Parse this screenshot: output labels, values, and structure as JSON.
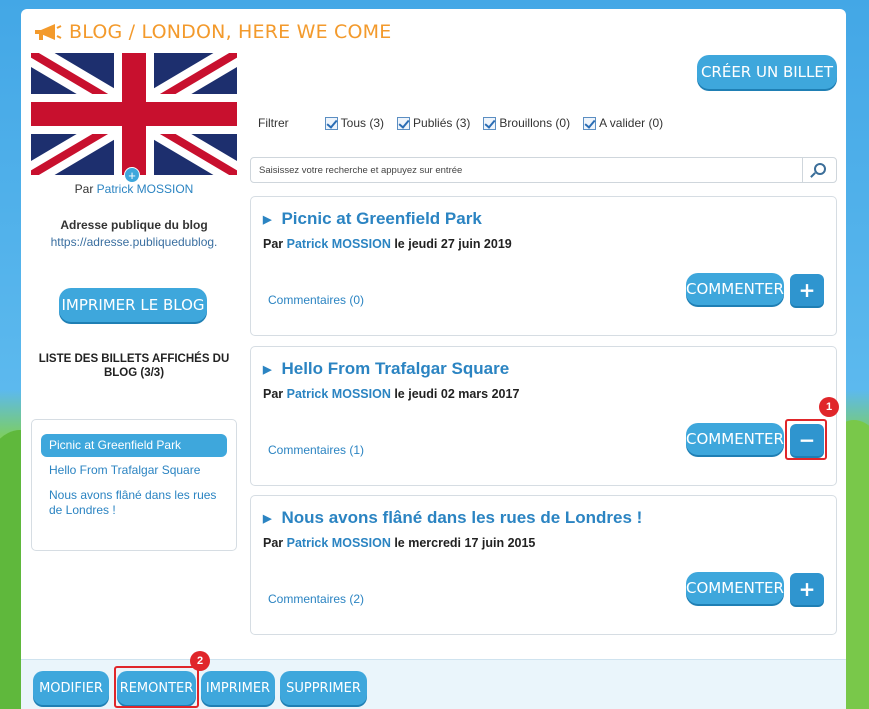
{
  "header": {
    "title": "BLOG / LONDON, HERE WE COME",
    "title_color": "#f39a2c"
  },
  "sidebar": {
    "par_prefix": "Par",
    "author": "Patrick MOSSION",
    "address_label": "Adresse publique du blog",
    "address_url": "https://adresse.publiquedublog.",
    "print_button": "IMPRIMER LE BLOG",
    "list_title": "LISTE DES BILLETS AFFICHÉS DU BLOG (3/3)",
    "items": [
      {
        "label": "Picnic at Greenfield Park",
        "active": true
      },
      {
        "label": "Hello From Trafalgar Square",
        "active": false
      },
      {
        "label": "Nous avons flâné dans les rues de Londres !",
        "active": false
      }
    ]
  },
  "toolbar": {
    "create_button": "CRÉER UN BILLET"
  },
  "filters": {
    "label": "Filtrer",
    "options": [
      {
        "label": "Tous (3)",
        "checked": true
      },
      {
        "label": "Publiés (3)",
        "checked": true
      },
      {
        "label": "Brouillons (0)",
        "checked": true
      },
      {
        "label": "A valider (0)",
        "checked": true
      }
    ]
  },
  "search": {
    "placeholder": "Saisissez votre recherche et appuyez sur entrée"
  },
  "posts": [
    {
      "title": "Picnic at Greenfield Park",
      "par": "Par",
      "author": "Patrick MOSSION",
      "date": "le jeudi 27 juin 2019",
      "comments": "Commentaires (0)",
      "comment_button": "COMMENTER",
      "toggle": "+"
    },
    {
      "title": "Hello From Trafalgar Square",
      "par": "Par",
      "author": "Patrick MOSSION",
      "date": "le jeudi 02 mars 2017",
      "comments": "Commentaires (1)",
      "comment_button": "COMMENTER",
      "toggle": "−"
    },
    {
      "title": "Nous avons flâné dans les rues de Londres !",
      "par": "Par",
      "author": "Patrick MOSSION",
      "date": "le mercredi 17 juin 2015",
      "comments": "Commentaires (2)",
      "comment_button": "COMMENTER",
      "toggle": "+"
    }
  ],
  "footer": {
    "buttons": [
      "MODIFIER",
      "REMONTER",
      "IMPRIMER",
      "SUPPRIMER"
    ]
  },
  "annotations": {
    "badge1": "1",
    "badge2": "2"
  },
  "colors": {
    "accent": "#3ea7dc",
    "link": "#2b84c2",
    "highlight": "#e0262a"
  }
}
